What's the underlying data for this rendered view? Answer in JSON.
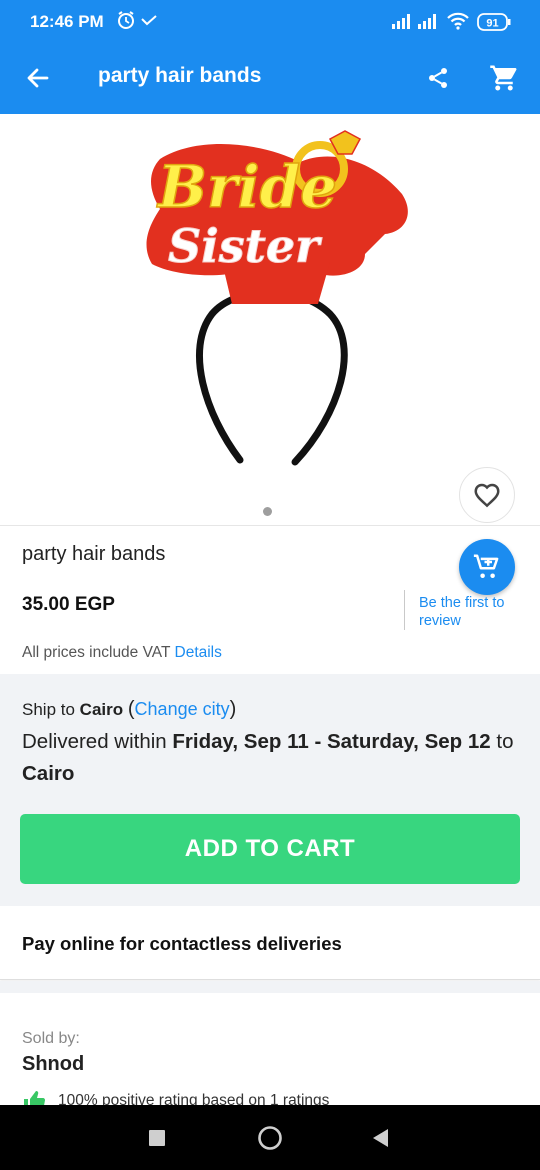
{
  "status_bar": {
    "time": "12:46 PM",
    "battery": "91",
    "icons": [
      "alarm-icon",
      "signal-icon",
      "wifi-icon",
      "battery-icon"
    ]
  },
  "app_bar": {
    "title": "party hair bands",
    "icons": [
      "back-arrow-icon",
      "share-icon",
      "cart-icon"
    ]
  },
  "gallery": {
    "image_alt_text": [
      "Bride",
      "Sister"
    ],
    "page_count": 1,
    "current_page": 1
  },
  "product": {
    "title": "party hair bands",
    "price": "35.00 EGP",
    "review_link": "Be the first to review",
    "vat_text": "All prices include VAT",
    "vat_link": "Details"
  },
  "shipping": {
    "ship_to_label": "Ship to",
    "city": "Cairo",
    "change_city": "Change city",
    "delivered_prefix": "Delivered within",
    "delivery_window": "Friday, Sep 11 - Saturday, Sep 12",
    "to_label": "to",
    "to_city": "Cairo",
    "add_to_cart": "ADD TO CART"
  },
  "contactless": {
    "text": "Pay online for contactless deliveries"
  },
  "seller": {
    "sold_by_label": "Sold by:",
    "name": "Shnod",
    "rating_text": "100% positive rating based on 1 ratings"
  },
  "colors": {
    "primary": "#1b8cf0",
    "add_to_cart": "#38d67f",
    "rating_green": "#38c764"
  }
}
